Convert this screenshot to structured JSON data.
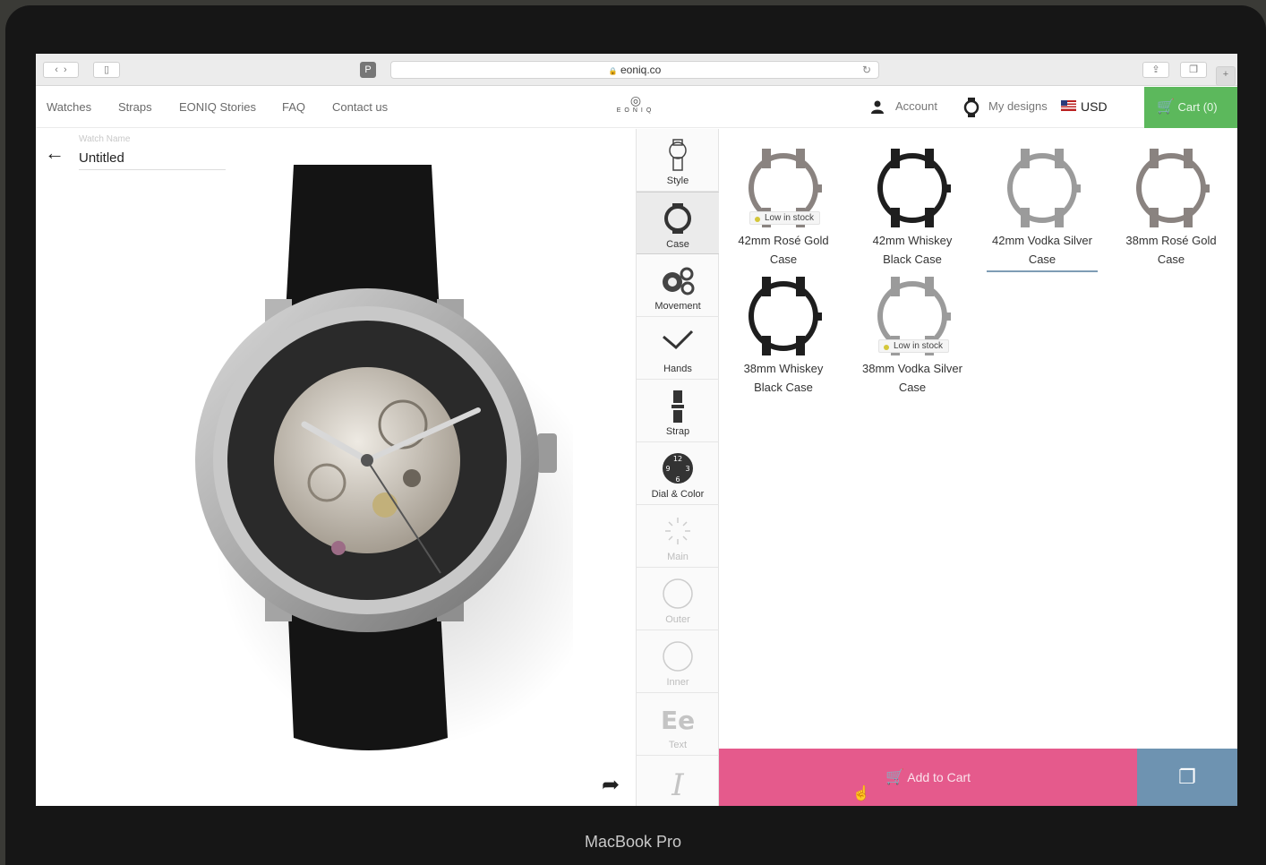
{
  "device": {
    "label": "MacBook Pro"
  },
  "browser": {
    "url": "eoniq.co",
    "lock_glyph": "🔒",
    "reload_glyph": "↻"
  },
  "header": {
    "nav": [
      "Watches",
      "Straps",
      "EONIQ Stories",
      "FAQ",
      "Contact us"
    ],
    "logo": "EONIQ",
    "account": "Account",
    "my_designs": "My designs",
    "currency": "USD",
    "cart": "Cart (0)"
  },
  "editor": {
    "name_label": "Watch Name",
    "name_value": "Untitled"
  },
  "tools": [
    {
      "label": "Style",
      "icon": "style-icon",
      "state": "normal"
    },
    {
      "label": "Case",
      "icon": "case-icon",
      "state": "active"
    },
    {
      "label": "Movement",
      "icon": "movement-icon",
      "state": "normal"
    },
    {
      "label": "Hands",
      "icon": "hands-icon",
      "state": "normal"
    },
    {
      "label": "Strap",
      "icon": "strap-icon",
      "state": "normal"
    },
    {
      "label": "Dial & Color",
      "icon": "dial-icon",
      "state": "normal"
    },
    {
      "label": "Main",
      "icon": "main-icon",
      "state": "dim"
    },
    {
      "label": "Outer",
      "icon": "outer-icon",
      "state": "dim"
    },
    {
      "label": "Inner",
      "icon": "inner-icon",
      "state": "dim"
    },
    {
      "label": "Text",
      "icon": "text-icon",
      "state": "dim"
    },
    {
      "label": "",
      "icon": "font-icon",
      "state": "dim"
    }
  ],
  "cases": [
    {
      "line1": "42mm Rosé Gold",
      "line2": "Case",
      "badge": "Low in stock",
      "color": "#8a8380",
      "selected": false
    },
    {
      "line1": "42mm Whiskey",
      "line2": "Black Case",
      "badge": "",
      "color": "#1e1e1e",
      "selected": false
    },
    {
      "line1": "42mm Vodka Silver",
      "line2": "Case",
      "badge": "",
      "color": "#9b9b9b",
      "selected": true
    },
    {
      "line1": "38mm Rosé Gold",
      "line2": "Case",
      "badge": "",
      "color": "#8a8380",
      "selected": false
    },
    {
      "line1": "38mm Whiskey",
      "line2": "Black Case",
      "badge": "",
      "color": "#1e1e1e",
      "selected": false
    },
    {
      "line1": "38mm Vodka Silver",
      "line2": "Case",
      "badge": "Low in stock",
      "color": "#9b9b9b",
      "selected": false
    }
  ],
  "actions": {
    "add_to_cart": "Add to Cart",
    "cart_glyph": "🛒",
    "copy_glyph": "❐"
  },
  "colors": {
    "cart_green": "#5cb85c",
    "add_to_cart_pink": "#e55a8c",
    "copy_blue": "#6e93b1",
    "low_stock_dot": "#d4c73a",
    "selected_underline": "#7e9cb5"
  }
}
